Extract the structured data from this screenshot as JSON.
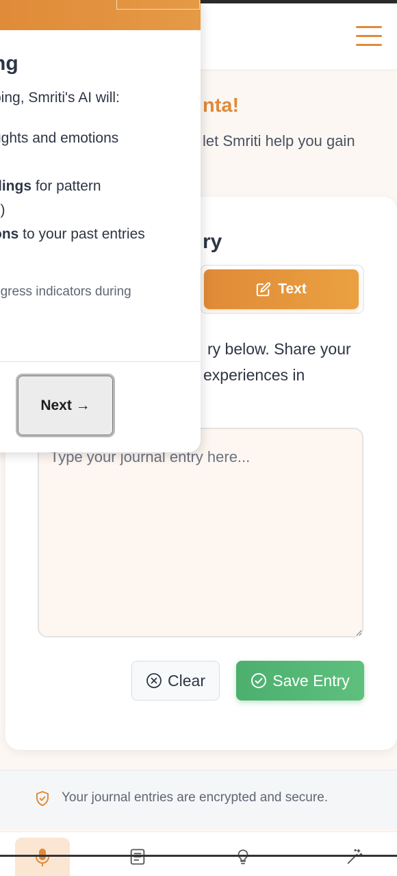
{
  "header": {
    "menu_icon": "hamburger-menu-icon"
  },
  "greeting": "nta!",
  "subtext": "l let Smriti help you gain",
  "entry_card": {
    "title": "ry",
    "mode_text_label": "Text",
    "instructions_line1": "ry below. Share your",
    "instructions_line2": "experiences in",
    "textarea_placeholder": "Type your journal entry here...",
    "clear_label": "Clear",
    "save_label": "Save Entry"
  },
  "security": {
    "text": "Your journal entries are encrypted and secure."
  },
  "bottom_nav": {
    "items": [
      {
        "icon": "microphone-icon",
        "active": true
      },
      {
        "icon": "journal-list-icon",
        "active": false
      },
      {
        "icon": "lightbulb-icon",
        "active": false
      },
      {
        "icon": "magic-wand-icon",
        "active": false
      }
    ]
  },
  "onboarding": {
    "title": "ng",
    "line1": "ping, Smriti's AI will:",
    "line2": "ughts and emotions",
    "line3_bold": "dings",
    "line3_rest": " for pattern",
    "line4": "s)",
    "line5_bold": "ons",
    "line5_rest": " to your past entries",
    "note": "ogress indicators during",
    "next_label": "Next →"
  },
  "colors": {
    "accent": "#e08a38",
    "save_green": "#4caf6e",
    "text_dark": "#2d3545"
  }
}
